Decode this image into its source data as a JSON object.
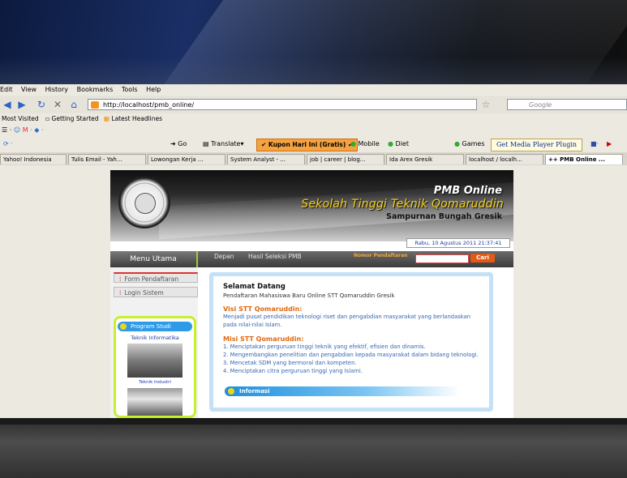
{
  "menubar": [
    "Edit",
    "View",
    "History",
    "Bookmarks",
    "Tools",
    "Help"
  ],
  "nav": {
    "url": "http://localhost/pmb_online/",
    "search_placeholder": "Google"
  },
  "bookmarks": [
    "Most Visited",
    "Getting Started",
    "Latest Headlines"
  ],
  "toolbar": {
    "go": "Go",
    "translate": "Translate",
    "kupon": "Kupon Hari Ini (Gratis)",
    "mobile": "Mobile",
    "diet": "Diet",
    "games": "Games",
    "media": "Get Media Player Plugin"
  },
  "tabs": [
    "Yahoo! Indonesia",
    "Tulis Email - Yah...",
    "Lowongan Kerja ...",
    "System Analyst - ...",
    "job | career | blog...",
    "Ida Arex Gresik",
    "localhost / localh...",
    "++ PMB Online ..."
  ],
  "site": {
    "pmb": "PMB Online",
    "school": "Sekolah Tinggi Teknik Qomaruddin",
    "address": "Sampurnan Bungah Gresik",
    "date": "Rabu, 10 Agustus 2011 21:37:41",
    "menu_title": "Menu Utama",
    "nav_links": [
      "Depan",
      "Hasil Seleksi PMB"
    ],
    "nomor_label": "Nomor Pendaftaran",
    "cari": "Cari",
    "side_items": [
      "Form Pendaftaran",
      "Login Sistem"
    ],
    "program_studi": "Program Studi",
    "prodi": [
      "Teknik Informatika",
      "Teknik Industri"
    ],
    "welcome": "Selamat Datang",
    "welcome_sub": "Pendaftaran Mahasiswa Baru Online STT Qomaruddin Gresik",
    "visi_title": "Visi STT Qomaruddin:",
    "visi_text": "Menjadi pusat pendidikan teknologi riset dan pengabdian masyarakat yang berlandaskan pada nilai-nilai Islam.",
    "misi_title": "Misi STT Qomaruddin:",
    "misi": [
      "1. Menciptakan perguruan tinggi teknik yang efektif, efisien dan dinamis.",
      "2. Mengembangkan penelitian dan pengabdian kepada masyarakat dalam bidang teknologi.",
      "3. Mencetak SDM yang bermoral dan kompeten.",
      "4. Menciptakan citra perguruan tinggi yang Islami."
    ],
    "informasi": "Informasi"
  }
}
